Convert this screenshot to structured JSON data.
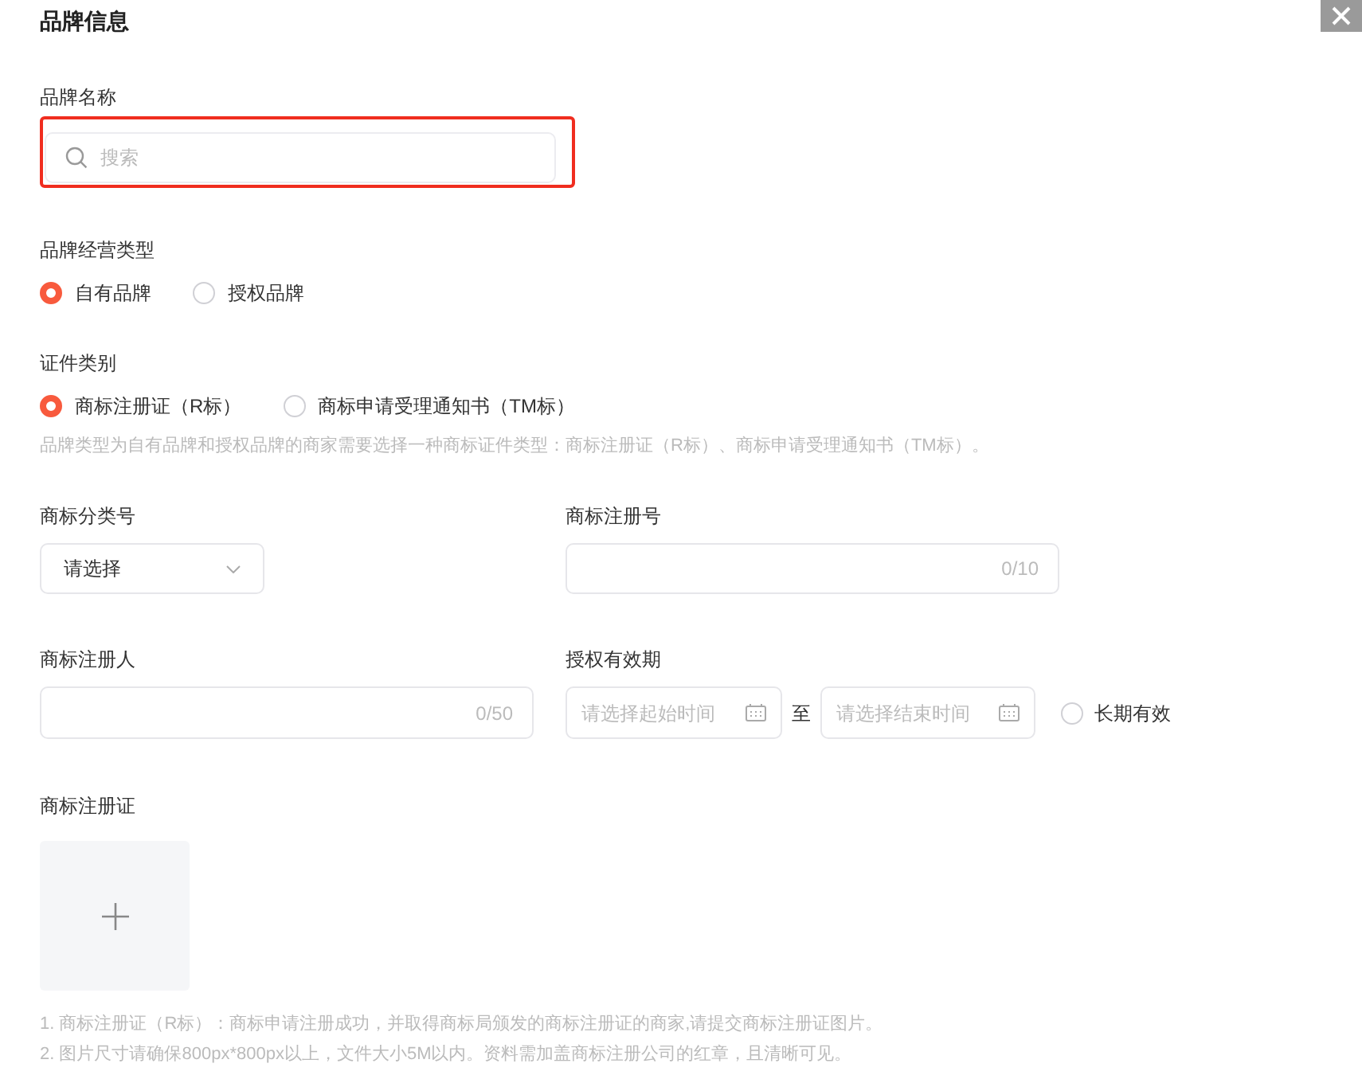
{
  "title": "品牌信息",
  "brand_name": {
    "label": "品牌名称",
    "placeholder": "搜索",
    "highlighted": true
  },
  "operation_type": {
    "label": "品牌经营类型",
    "options": [
      {
        "label": "自有品牌",
        "selected": true
      },
      {
        "label": "授权品牌",
        "selected": false
      }
    ]
  },
  "certificate_type": {
    "label": "证件类别",
    "options": [
      {
        "label": "商标注册证（R标）",
        "selected": true
      },
      {
        "label": "商标申请受理通知书（TM标）",
        "selected": false
      }
    ],
    "hint": "品牌类型为自有品牌和授权品牌的商家需要选择一种商标证件类型：商标注册证（R标）、商标申请受理通知书（TM标）。"
  },
  "class_number": {
    "label": "商标分类号",
    "value": "请选择"
  },
  "registration_number": {
    "label": "商标注册号",
    "counter": "0/10"
  },
  "registrant": {
    "label": "商标注册人",
    "counter": "0/50"
  },
  "validity": {
    "label": "授权有效期",
    "start_placeholder": "请选择起始时间",
    "separator": "至",
    "end_placeholder": "请选择结束时间",
    "long_term": {
      "label": "长期有效",
      "checked": false
    }
  },
  "certificate_upload": {
    "label": "商标注册证",
    "notes": [
      "1. 商标注册证（R标）：商标申请注册成功，并取得商标局颁发的商标注册证的商家,请提交商标注册证图片。",
      "2. 图片尺寸请确保800px*800px以上，文件大小5M以内。资料需加盖商标注册公司的红章，且清晰可见。"
    ]
  }
}
